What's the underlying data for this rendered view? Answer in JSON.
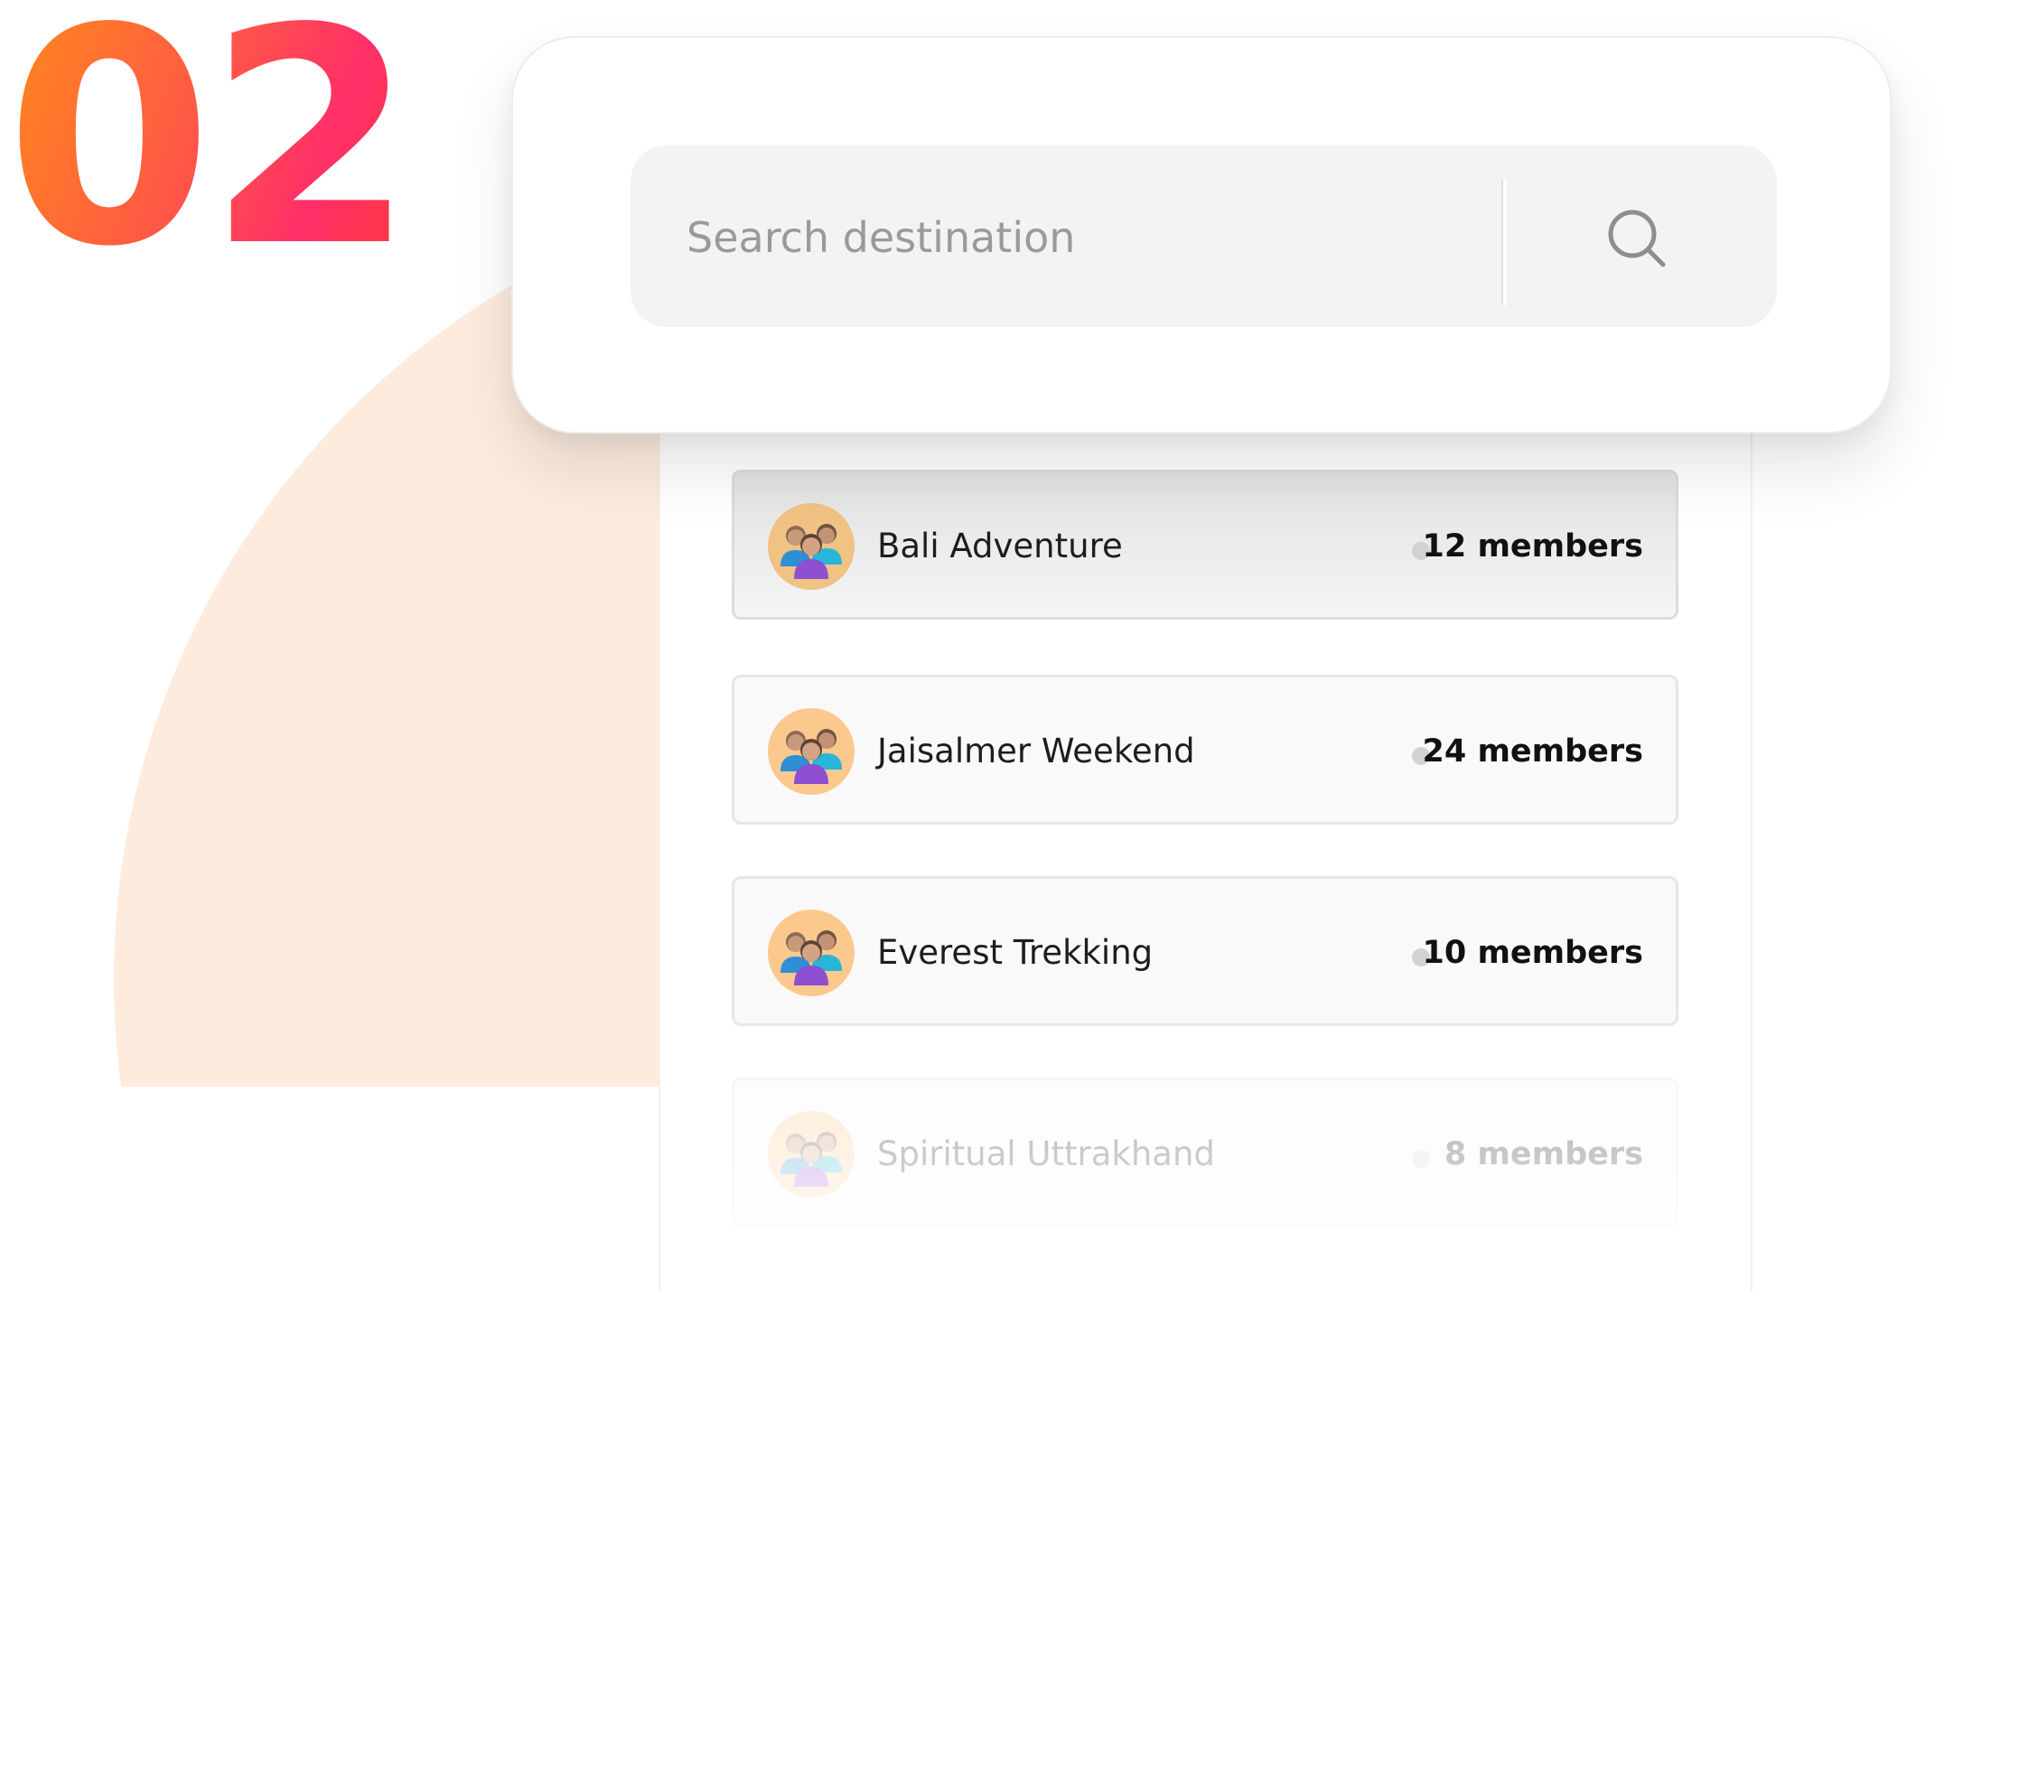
{
  "step": {
    "number": "02"
  },
  "search": {
    "placeholder": "Search destination",
    "value": "",
    "icon": "search-icon"
  },
  "groups": [
    {
      "name": "Bali Adventure",
      "members": "12 members",
      "icon": "group-people-icon",
      "state": "highlighted"
    },
    {
      "name": "Jaisalmer Weekend",
      "members": "24 members",
      "icon": "group-people-icon",
      "state": "normal"
    },
    {
      "name": "Everest Trekking",
      "members": "10 members",
      "icon": "group-people-icon",
      "state": "normal"
    },
    {
      "name": "Spiritual Uttrakhand",
      "members": "8 members",
      "icon": "group-people-icon",
      "state": "faded"
    }
  ],
  "colors": {
    "accent_gradient_start": "#ff8a1a",
    "accent_gradient_end": "#ff2f68",
    "background_arc": "#fdebde",
    "avatar_background": "#fbc98e",
    "status_dot": "#d2d2d2"
  }
}
